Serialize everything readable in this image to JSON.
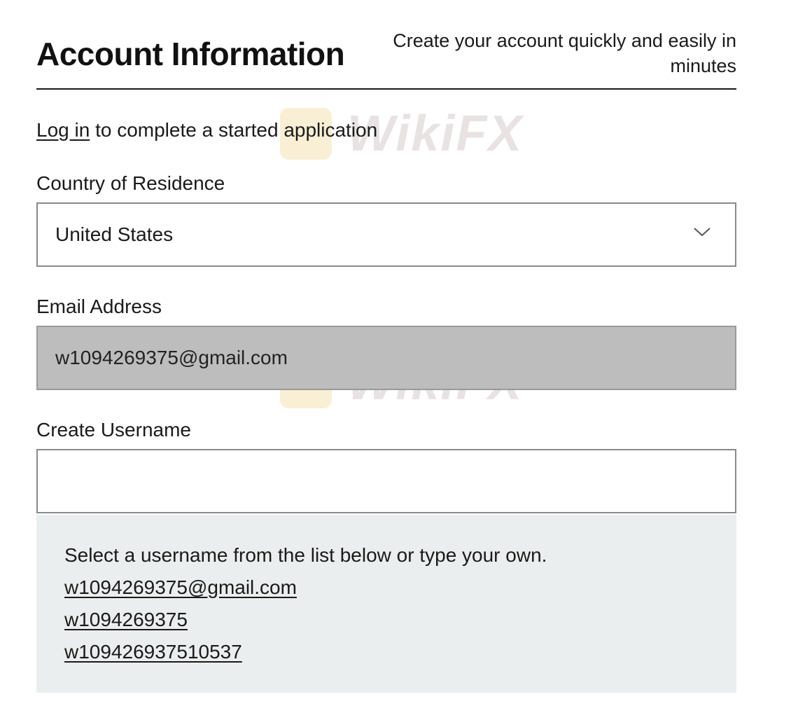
{
  "header": {
    "title": "Account Information",
    "subtitle": "Create your account quickly and easily in minutes"
  },
  "login": {
    "link_label": "Log in",
    "rest_text": " to complete a started application"
  },
  "country": {
    "label": "Country of Residence",
    "value": "United States",
    "icon": "chevron-down-icon"
  },
  "email": {
    "label": "Email Address",
    "value": "w1094269375@gmail.com"
  },
  "username": {
    "label": "Create Username",
    "value": "",
    "hint": "Select a username from the list below or type your own.",
    "options": [
      "w1094269375@gmail.com",
      "w1094269375",
      "w109426937510537"
    ]
  },
  "watermark": {
    "text": "WikiFX",
    "logo_color": "#f5e3b3"
  }
}
